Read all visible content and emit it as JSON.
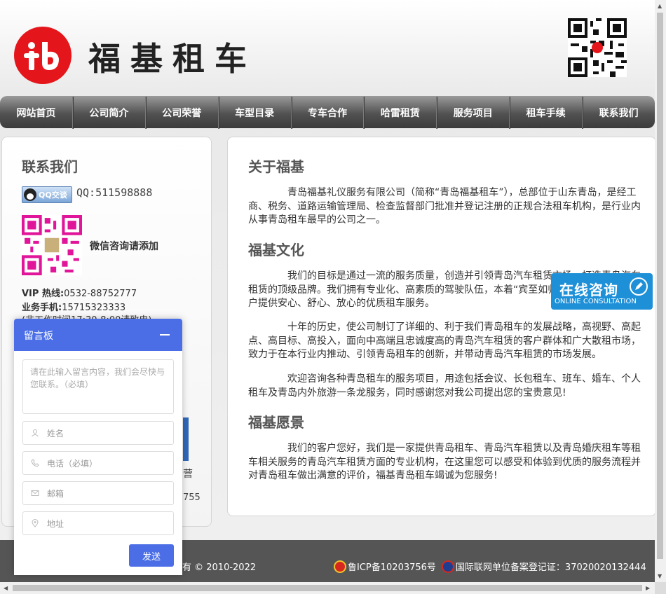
{
  "header": {
    "brand": "福基租车"
  },
  "nav": {
    "items": [
      "网站首页",
      "公司简介",
      "公司荣誉",
      "车型目录",
      "专车合作",
      "哈雷租赁",
      "服务项目",
      "租车手续",
      "联系我们"
    ]
  },
  "contact": {
    "title": "联系我们",
    "qq_badge": "QQ交谈",
    "qq_number": "QQ:511598888",
    "wechat_label": "微信咨询请添加",
    "vip_label": "VIP 热线:",
    "vip_number": "0532-88752777",
    "mobile_label": "业务手机:",
    "mobile_number": "15715323333",
    "note": "(非工作时间17:30-8:00请致电)",
    "partial1": "营",
    "partial2": "755"
  },
  "main": {
    "about_title": "关于福基",
    "about_text": "青岛福基礼仪服务有限公司（简称“青岛福基租车”），总部位于山东青岛，是经工商、税务、道路运输管理局、检查监督部门批准并登记注册的正规合法租车机构，是行业内从事青岛租车最早的公司之一。",
    "culture_title": "福基文化",
    "culture_text1": "我们的目标是通过一流的服务质量，创造并引领青岛汽车租赁市场，打造青岛汽车租赁的顶级品牌。我们拥有专业化、高素质的驾驶队伍，本着“宾至如归”的宗旨，为青岛客户提供安心、舒心、放心的优质租车服务。",
    "culture_text2": "十年的历史，使公司制订了详细的、利于我们青岛租车的发展战略，高视野、高起点、高目标、高投入，面向中高端且忠诚度高的青岛汽车租赁的客户群体和广大散租市场，致力于在本行业内推动、引领青岛租车的创新，并带动青岛汽车租赁的市场发展。",
    "culture_text3": "欢迎咨询各种青岛租车的服务项目，用途包括会议、长包租车、班车、婚车、个人租车及青岛内外旅游一条龙服务，同时感谢您对我公司提出您的宝贵意见!",
    "vision_title": "福基愿景",
    "vision_text": "我们的客户您好，我们是一家提供青岛租车、青岛汽车租赁以及青岛婚庆租车等租车相关服务的青岛汽车租赁方面的专业机构，在这里您可以感受和体验到优质的服务流程并对青岛租车做出满意的评价，福基青岛租车竭诚为您服务!"
  },
  "consult": {
    "cn": "在线咨询",
    "en": "ONLINE CONSULTATION"
  },
  "footer": {
    "copyright": "有 © 2010-2022",
    "icp": "鲁ICP备10203756号",
    "police": "国际联网单位备案登记证：37020020132444"
  },
  "board": {
    "title": "留言板",
    "message_placeholder": "请在此输入留言内容，我们会尽快与您联系。（必填）",
    "name_placeholder": "姓名",
    "phone_placeholder": "电话（必填）",
    "email_placeholder": "邮箱",
    "address_placeholder": "地址",
    "send": "发送"
  },
  "colors": {
    "brand_red": "#e4161b",
    "board_blue": "#4b6ee6",
    "consult_blue": "#1e90d8"
  }
}
